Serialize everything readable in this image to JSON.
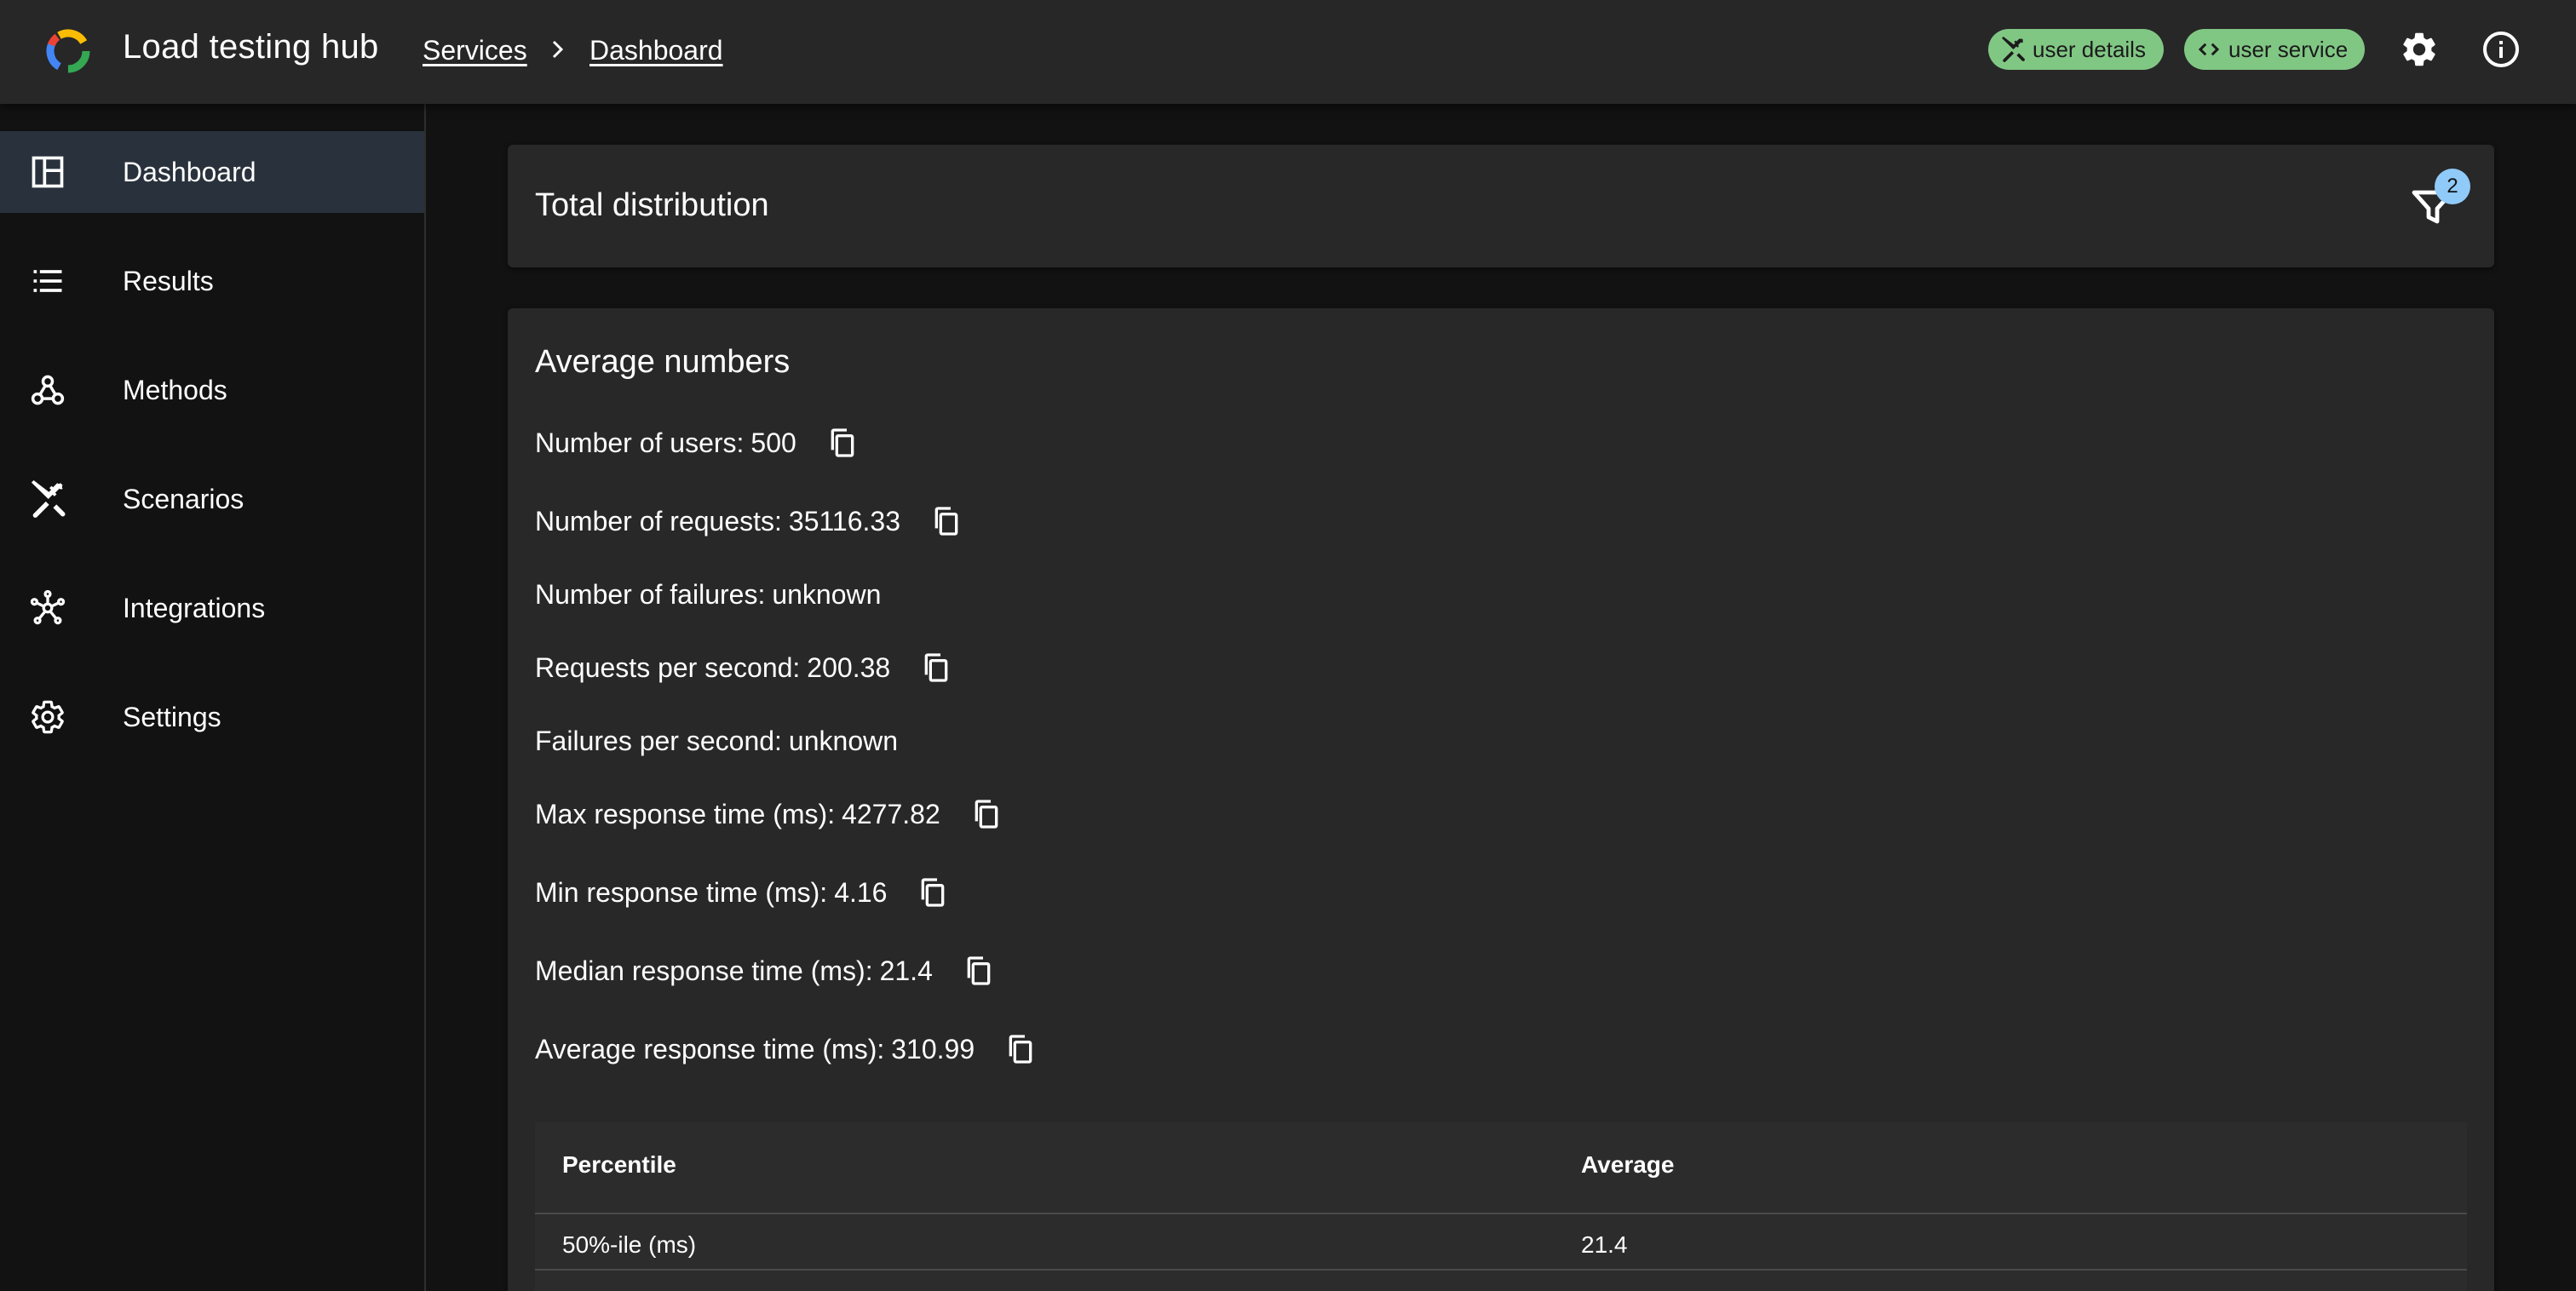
{
  "app": {
    "title": "Load testing hub"
  },
  "breadcrumbs": [
    "Services",
    "Dashboard"
  ],
  "chips": [
    {
      "label": "user details",
      "icon": "tools-icon",
      "color": "#81c784"
    },
    {
      "label": "user service",
      "icon": "code-icon",
      "color": "#81c784"
    }
  ],
  "sidebar": {
    "items": [
      {
        "label": "Dashboard",
        "icon": "dashboard-icon",
        "active": true
      },
      {
        "label": "Results",
        "icon": "list-icon"
      },
      {
        "label": "Methods",
        "icon": "webhook-icon"
      },
      {
        "label": "Scenarios",
        "icon": "tools-icon"
      },
      {
        "label": "Integrations",
        "icon": "hub-icon"
      },
      {
        "label": "Settings",
        "icon": "gear-icon"
      }
    ]
  },
  "distribution": {
    "title": "Total distribution",
    "filter_count": "2"
  },
  "average": {
    "title": "Average numbers",
    "stats": [
      {
        "label": "Number of users:",
        "value": "500",
        "copyable": true
      },
      {
        "label": "Number of requests:",
        "value": "35116.33",
        "copyable": true
      },
      {
        "label": "Number of failures:",
        "value": "unknown",
        "copyable": false
      },
      {
        "label": "Requests per second:",
        "value": "200.38",
        "copyable": true
      },
      {
        "label": "Failures per second:",
        "value": "unknown",
        "copyable": false
      },
      {
        "label": "Max response time (ms):",
        "value": "4277.82",
        "copyable": true
      },
      {
        "label": "Min response time (ms):",
        "value": "4.16",
        "copyable": true
      },
      {
        "label": "Median response time (ms):",
        "value": "21.4",
        "copyable": true
      },
      {
        "label": "Average response time (ms):",
        "value": "310.99",
        "copyable": true
      }
    ]
  },
  "percentile_table": {
    "headers": [
      "Percentile",
      "Average"
    ],
    "rows": [
      [
        "50%-ile (ms)",
        "21.4"
      ]
    ]
  },
  "colors": {
    "accent": "#90caf9",
    "chip": "#81c784",
    "active_nav": "#29323c"
  }
}
